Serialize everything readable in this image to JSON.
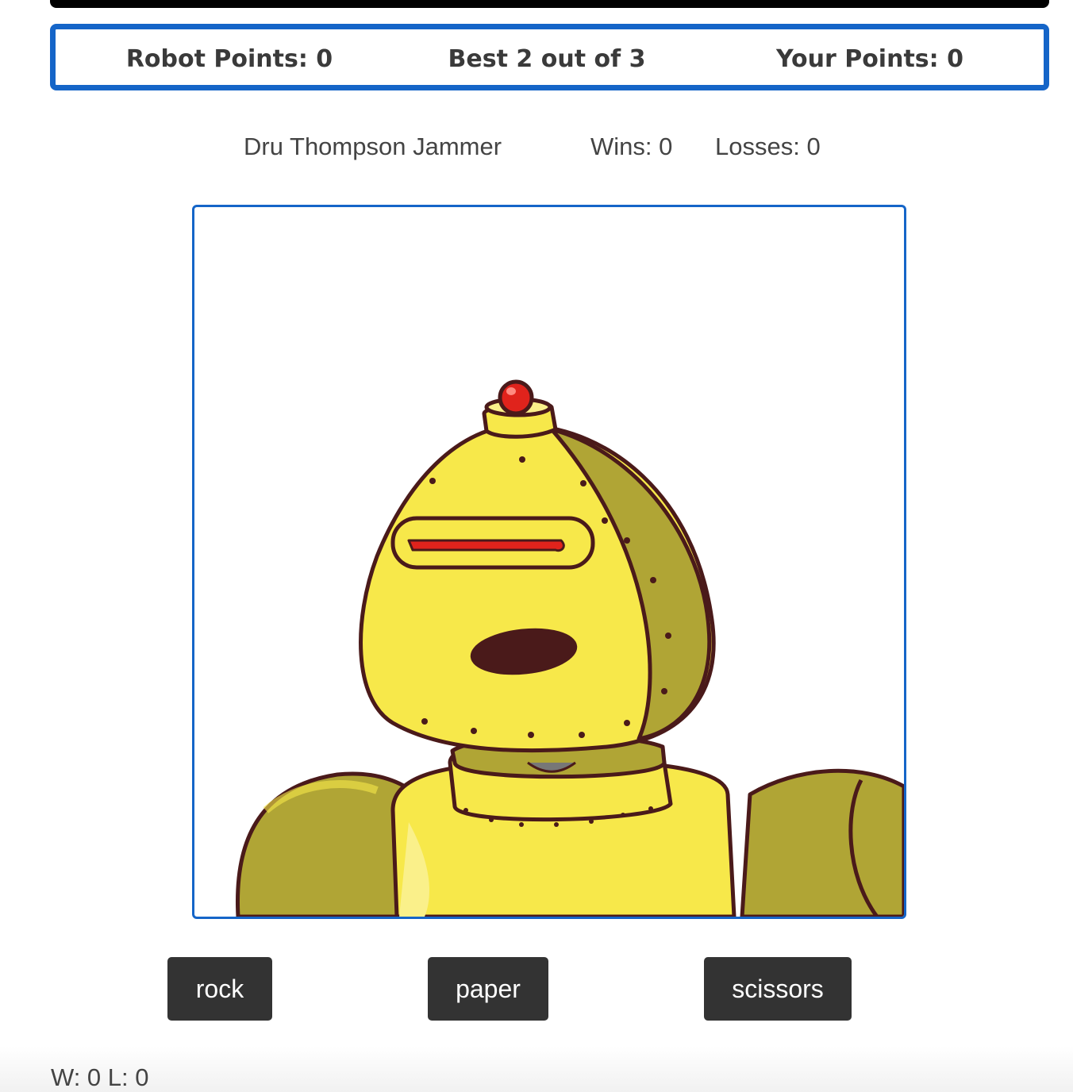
{
  "scoreboard": {
    "robot_points": "Robot Points: 0",
    "best_of": "Best 2 out of 3",
    "your_points": "Your Points: 0"
  },
  "player": {
    "name": "Dru Thompson Jammer",
    "wins": "Wins: 0",
    "losses": "Losses: 0"
  },
  "opponent": {
    "image": "yellow-robot-illustration"
  },
  "moves": {
    "rock": "rock",
    "paper": "paper",
    "scissors": "scissors"
  },
  "footer": {
    "record": "W: 0 L: 0"
  },
  "colors": {
    "accent_border": "#1565c8",
    "button_bg": "#333333",
    "button_text": "#ffffff",
    "robot_yellow": "#f7e84a",
    "robot_shade": "#b0a535",
    "robot_outline": "#4a1a1a",
    "robot_light": "#e0231c"
  }
}
